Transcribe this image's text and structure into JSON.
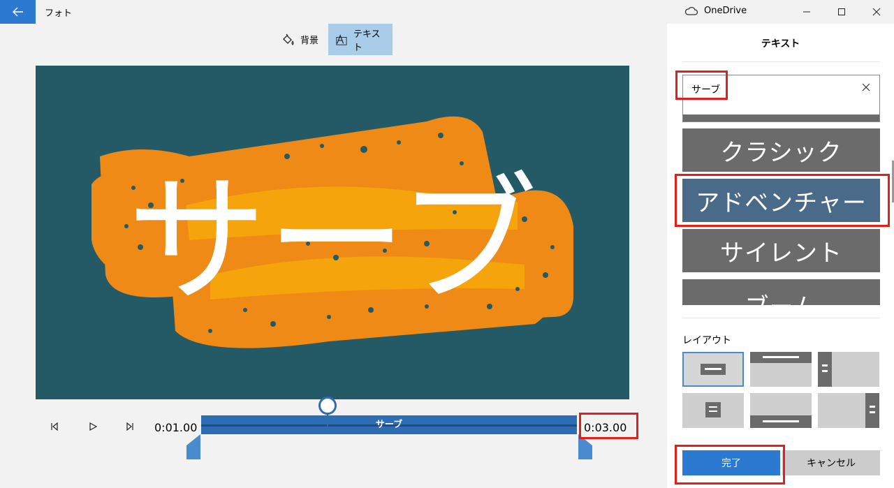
{
  "app": {
    "title": "フォト",
    "cloud_label": "OneDrive"
  },
  "toolbar": {
    "background_label": "背景",
    "text_label": "テキスト"
  },
  "preview": {
    "overlay_text": "サーブ",
    "bg_color": "#235a66",
    "accent_color": "#ee8a15"
  },
  "playback": {
    "start_time": "0:01.00",
    "end_time": "0:03.00",
    "clip_label": "サーブ"
  },
  "panel": {
    "title": "テキスト",
    "input_value": "サーブ",
    "styles": [
      {
        "label": "クラシック",
        "selected": false
      },
      {
        "label": "アドベンチャー",
        "selected": true
      },
      {
        "label": "サイレント",
        "selected": false
      },
      {
        "label": "ブーム",
        "selected": false
      }
    ],
    "layout_label": "レイアウト",
    "done_label": "完了",
    "cancel_label": "キャンセル"
  },
  "colors": {
    "accent": "#2b79d0",
    "highlight": "#e0201a",
    "selected_style": "#4a6a89"
  }
}
